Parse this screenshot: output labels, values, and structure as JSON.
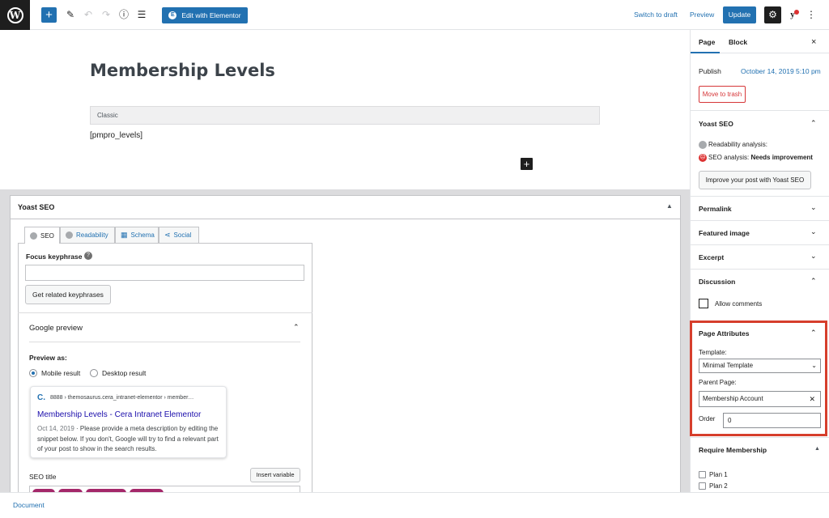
{
  "toolbar": {
    "add_block": "+",
    "edit_with_elementor": "Edit with Elementor",
    "switch_to_draft": "Switch to draft",
    "preview": "Preview",
    "update": "Update",
    "yoast_logo": "y"
  },
  "editor": {
    "title": "Membership Levels",
    "classic_label": "Classic",
    "shortcode": "[pmpro_levels]",
    "add_block": "+"
  },
  "yoast_box": {
    "title": "Yoast SEO",
    "tabs": [
      {
        "label": "SEO",
        "icon": "gray-dot-icon"
      },
      {
        "label": "Readability",
        "icon": "gray-dot-icon"
      },
      {
        "label": "Schema",
        "icon": "grid-icon"
      },
      {
        "label": "Social",
        "icon": "share-icon"
      }
    ],
    "focus_keyphrase_label": "Focus keyphrase",
    "focus_keyphrase_value": "",
    "related_button": "Get related keyphrases",
    "google_preview_title": "Google preview",
    "preview_as_label": "Preview as:",
    "mobile_result": "Mobile result",
    "desktop_result": "Desktop result",
    "preview_mode": "mobile",
    "serp": {
      "url": "8888 › themosaurus.cera_intranet-elementor › member…",
      "title": "Membership Levels - Cera Intranet Elementor",
      "date": "Oct 14, 2019",
      "description": "· Please provide a meta description by editing the snippet below. If you don't, Google will try to find a relevant part of your post to show in the search results."
    },
    "seo_title_label": "SEO title",
    "insert_variable": "Insert variable"
  },
  "footer": {
    "breadcrumb": "Document"
  },
  "sidebar": {
    "tabs": [
      "Page",
      "Block"
    ],
    "close": "×",
    "publish_label": "Publish",
    "publish_date": "October 14, 2019 5:10 pm",
    "move_to_trash": "Move to trash",
    "yoast_section": "Yoast SEO",
    "readability_label": "Readability analysis:",
    "seo_analysis_label": "SEO analysis: ",
    "seo_analysis_value": "Needs improvement",
    "improve_button": "Improve your post with Yoast SEO",
    "permalink": "Permalink",
    "featured_image": "Featured image",
    "excerpt": "Excerpt",
    "discussion": "Discussion",
    "allow_comments": "Allow comments",
    "page_attributes": "Page Attributes",
    "template_label": "Template:",
    "template_value": "Minimal Template",
    "parent_label": "Parent Page:",
    "parent_value": "Membership Account",
    "order_label": "Order",
    "order_value": "0",
    "require_membership": "Require Membership",
    "plans": [
      "Plan 1",
      "Plan 2"
    ]
  },
  "colors": {
    "accent": "#2271b1",
    "highlight_frame": "#d63e2c",
    "error": "#d63638",
    "yoast_pill": "#a4286a"
  }
}
